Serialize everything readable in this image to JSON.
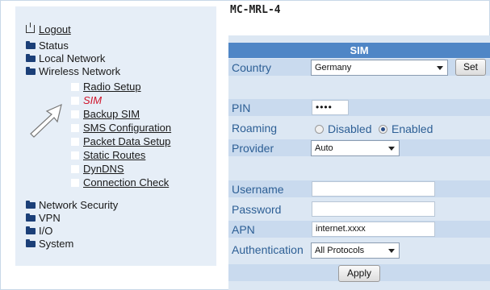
{
  "model": "MC-MRL-4",
  "nav": {
    "logout": "Logout",
    "status": "Status",
    "local_network": "Local Network",
    "wireless_network": "Wireless Network",
    "sub": [
      "Radio Setup",
      "SIM",
      "Backup SIM",
      "SMS Configuration",
      "Packet Data Setup",
      "Static Routes",
      "DynDNS",
      "Connection Check"
    ],
    "network_security": "Network Security",
    "vpn": "VPN",
    "io": "I/O",
    "system": "System"
  },
  "sim": {
    "header": "SIM",
    "country_label": "Country",
    "country_value": "Germany",
    "set_button": "Set",
    "pin_label": "PIN",
    "pin_value": "••••",
    "roaming_label": "Roaming",
    "roaming_disabled": "Disabled",
    "roaming_enabled": "Enabled",
    "roaming_selected": "Enabled",
    "provider_label": "Provider",
    "provider_value": "Auto",
    "username_label": "Username",
    "username_value": "",
    "password_label": "Password",
    "password_value": "",
    "apn_label": "APN",
    "apn_value": "internet.xxxx",
    "auth_label": "Authentication",
    "auth_value": "All Protocols",
    "apply_button": "Apply"
  }
}
